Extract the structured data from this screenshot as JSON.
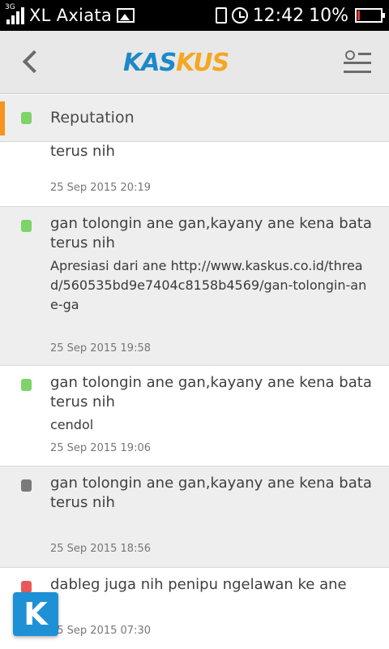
{
  "status_bar": {
    "network": "3G",
    "carrier": "XL Axiata",
    "time": "12:42",
    "battery_percent": "10%",
    "battery_level": 0.1,
    "icons": [
      "signal-icon",
      "image-notification-icon",
      "vibrate-icon",
      "alarm-icon",
      "battery-icon"
    ]
  },
  "header": {
    "logo_part1": "KAS",
    "logo_part2": "KUS",
    "logo_colors": {
      "part1": "#1e88c8",
      "part2": "#f5a623"
    }
  },
  "section": {
    "title": "Reputation",
    "accent_color": "#f7941d"
  },
  "colors": {
    "positive": "#7ed36a",
    "neutral": "#7a7a7a",
    "negative": "#e85a5a"
  },
  "reputation_items": [
    {
      "headline": "terus nih",
      "body": "",
      "time": "25 Sep 2015 20:19",
      "status": "positive"
    },
    {
      "headline": "gan tolongin ane gan,kayany ane kena bata terus nih",
      "body": "Apresiasi dari ane http://www.kaskus.co.id/thread/560535bd9e7404c8158b4569/gan-tolongin-ane-ga",
      "time": "25 Sep 2015 19:58",
      "status": "positive"
    },
    {
      "headline": "gan tolongin ane gan,kayany ane kena bata terus nih",
      "body": "cendol",
      "time": "25 Sep 2015 19:06",
      "status": "positive"
    },
    {
      "headline": "gan tolongin ane gan,kayany ane kena bata terus nih",
      "body": "",
      "time": "25 Sep 2015 18:56",
      "status": "neutral"
    },
    {
      "headline": "dableg juga nih penipu ngelawan ke ane",
      "body": "",
      "time": "25 Sep 2015 07:30",
      "status": "negative"
    }
  ],
  "fab": {
    "label": "K"
  }
}
